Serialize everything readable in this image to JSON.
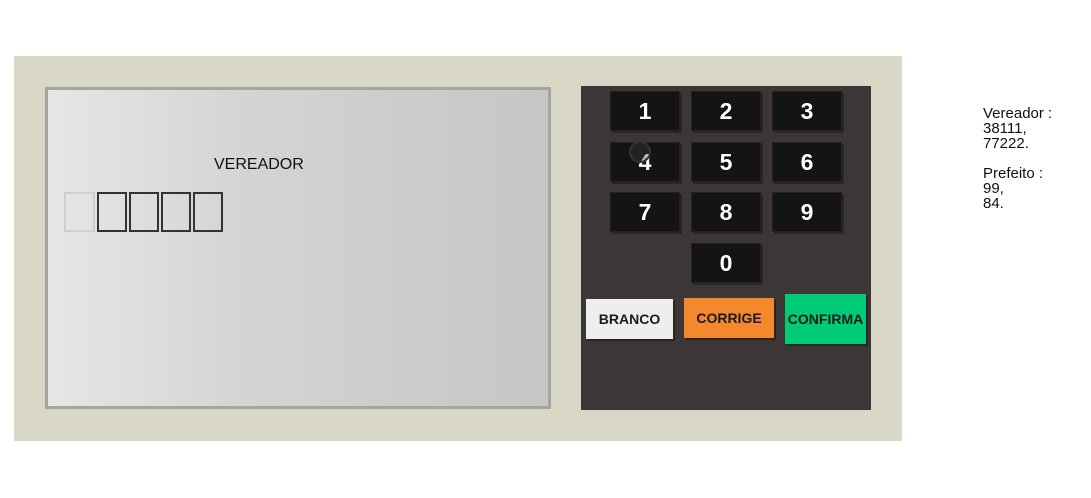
{
  "screen": {
    "title": "VEREADOR",
    "digit_boxes": [
      "",
      "",
      "",
      "",
      ""
    ]
  },
  "keypad": {
    "keys": [
      "1",
      "2",
      "3",
      "4",
      "5",
      "6",
      "7",
      "8",
      "9",
      "0"
    ],
    "actions": {
      "branco": "BRANCO",
      "corrige": "CORRIGE",
      "confirma": "CONFIRMA"
    }
  },
  "results": {
    "vereador_label": "Vereador :",
    "vereador_values": [
      "38111,",
      "77222."
    ],
    "prefeito_label": "Prefeito :",
    "prefeito_values": [
      "99,",
      "84."
    ]
  },
  "colors": {
    "machine_body": "#d9d7c6",
    "keypad_bg": "#3c3636",
    "key_bg": "#141414",
    "branco": "#eeeeee",
    "corrige": "#f3882c",
    "confirma": "#00cc77"
  }
}
